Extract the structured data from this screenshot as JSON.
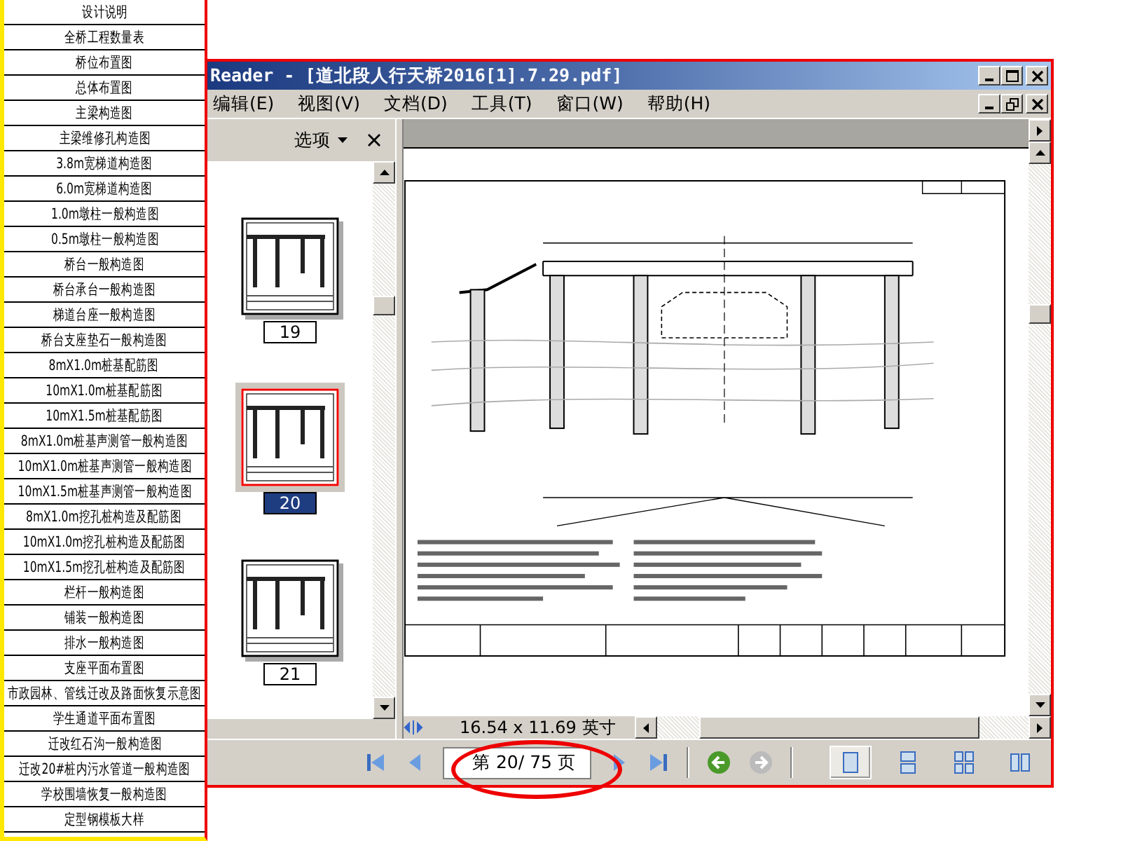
{
  "drawing_list": [
    "设计说明",
    "全桥工程数量表",
    "桥位布置图",
    "总体布置图",
    "主梁构造图",
    "主梁维修孔构造图",
    "3.8m宽梯道构造图",
    "6.0m宽梯道构造图",
    "1.0m墩柱一般构造图",
    "0.5m墩柱一般构造图",
    "桥台一般构造图",
    "桥台承台一般构造图",
    "梯道台座一般构造图",
    "桥台支座垫石一般构造图",
    "8mX1.0m桩基配筋图",
    "10mX1.0m桩基配筋图",
    "10mX1.5m桩基配筋图",
    "8mX1.0m桩基声测管一般构造图",
    "10mX1.0m桩基声测管一般构造图",
    "10mX1.5m桩基声测管一般构造图",
    "8mX1.0m挖孔桩构造及配筋图",
    "10mX1.0m挖孔桩构造及配筋图",
    "10mX1.5m挖孔桩构造及配筋图",
    "栏杆一般构造图",
    "铺装一般构造图",
    "排水一般构造图",
    "支座平面布置图",
    "市政园林、管线迁改及路面恢复示意图",
    "学生通道平面布置图",
    "迁改红石沟一般构造图",
    "迁改20#桩内污水管道一般构造图",
    "学校围墙恢复一般构造图",
    "定型钢模板大样"
  ],
  "window": {
    "title": "Reader - [道北段人行天桥2016[1].7.29.pdf]"
  },
  "menu": [
    "编辑(E)",
    "视图(V)",
    "文档(D)",
    "工具(T)",
    "窗口(W)",
    "帮助(H)"
  ],
  "thumbnail_panel": {
    "options_label": "选项",
    "thumbnails": [
      {
        "page": "19",
        "selected": false
      },
      {
        "page": "20",
        "selected": true
      },
      {
        "page": "21",
        "selected": false
      }
    ]
  },
  "page_size": "16.54 x 11.69 英寸",
  "navigation": {
    "page_field": "第 20/ 75 页",
    "history_buttons": [
      {
        "kind": "back",
        "disabled": false
      },
      {
        "kind": "forward",
        "disabled": true
      }
    ],
    "view_modes": [
      {
        "kind": "single",
        "selected": true
      },
      {
        "kind": "continuous",
        "selected": false
      },
      {
        "kind": "grid",
        "selected": false
      },
      {
        "kind": "facing",
        "selected": false
      }
    ]
  }
}
